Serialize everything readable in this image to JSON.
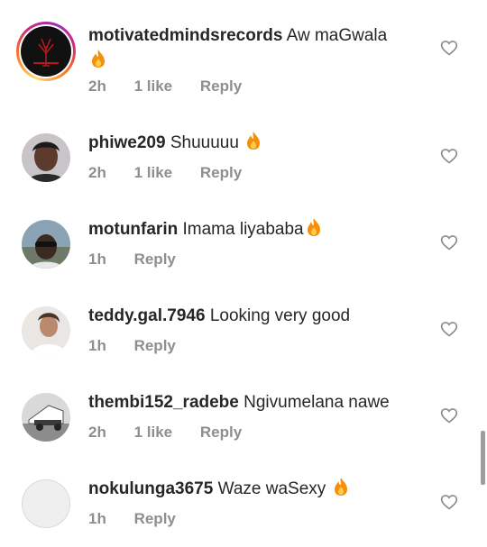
{
  "comments": [
    {
      "username": "motivatedmindsrecords",
      "text": "Aw maGwala",
      "time": "2h",
      "likes": "1 like",
      "reply": "Reply"
    },
    {
      "username": "phiwe209",
      "text": "Shuuuuu",
      "time": "2h",
      "likes": "1 like",
      "reply": "Reply"
    },
    {
      "username": "motunfarin",
      "text": "Imama liyababa",
      "time": "1h",
      "likes": "",
      "reply": "Reply"
    },
    {
      "username": "teddy.gal.7946",
      "text": "Looking very good",
      "time": "1h",
      "likes": "",
      "reply": "Reply"
    },
    {
      "username": "thembi152_radebe",
      "text": "Ngivumelana nawe",
      "time": "2h",
      "likes": "1 like",
      "reply": "Reply"
    },
    {
      "username": "nokulunga3675",
      "text": "Waze waSexy",
      "time": "1h",
      "likes": "",
      "reply": "Reply"
    }
  ],
  "icons": {
    "fire": "fire-emoji-icon",
    "like": "heart-outline-icon"
  },
  "colors": {
    "username": "#262626",
    "meta": "#8e8e8e",
    "heart": "#8e8e8e"
  }
}
